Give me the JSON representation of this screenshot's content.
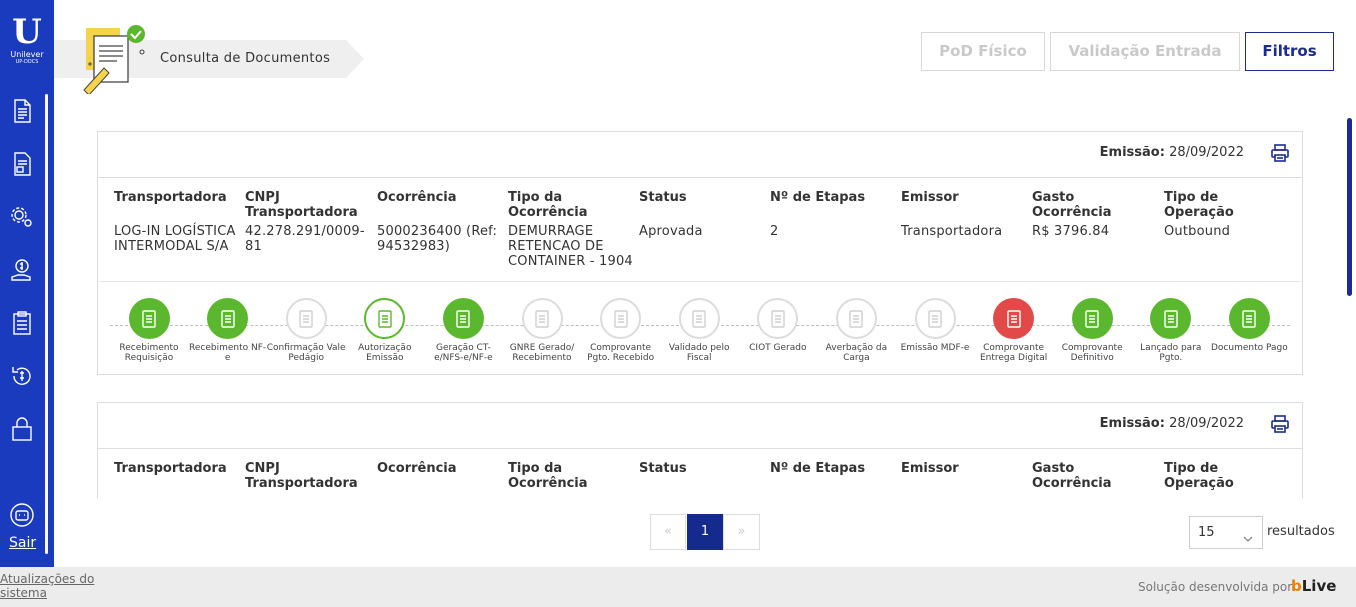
{
  "sidebar": {
    "logo_mark": "U",
    "logo_brand": "Unilever",
    "logo_sub": "UP-DOCS",
    "items": [
      {
        "icon": "document-icon"
      },
      {
        "icon": "document-list-icon"
      },
      {
        "icon": "settings-icon"
      },
      {
        "icon": "money-hand-icon"
      },
      {
        "icon": "clipboard-icon"
      },
      {
        "icon": "currency-return-icon"
      },
      {
        "icon": "lock-icon"
      },
      {
        "icon": "robot-icon"
      }
    ],
    "sair": "Sair"
  },
  "header": {
    "breadcrumb": "Consulta de Documentos",
    "buttons": {
      "pod": "PoD Físico",
      "validacao": "Validação Entrada",
      "filtros": "Filtros"
    }
  },
  "cards": [
    {
      "emissao_label": "Emissão:",
      "emissao_date": "28/09/2022",
      "columns": [
        {
          "header": "Transportadora",
          "value": "LOG-IN LOGÍSTICA INTERMODAL S/A"
        },
        {
          "header": "CNPJ Transportadora",
          "value": "42.278.291/0009-81"
        },
        {
          "header": "Ocorrência",
          "value": "5000236400 (Ref: 94532983)"
        },
        {
          "header": "Tipo da Ocorrência",
          "value": "DEMURRAGE RETENCAO DE CONTAINER - 1904"
        },
        {
          "header": "Status",
          "value": "Aprovada"
        },
        {
          "header": "Nº de Etapas",
          "value": "2"
        },
        {
          "header": "Emissor",
          "value": "Transportadora"
        },
        {
          "header": "Gasto Ocorrência",
          "value": "R$ 3796.84"
        },
        {
          "header": "Tipo de Operação",
          "value": "Outbound"
        }
      ],
      "steps": [
        {
          "label": "Recebimento Requisição",
          "state": "done",
          "icon": "receipt-download-icon"
        },
        {
          "label": "Recebimento NF-e",
          "state": "done",
          "icon": "invoice-icon"
        },
        {
          "label": "Confirmação Vale Pedágio",
          "state": "pending",
          "icon": "toll-icon"
        },
        {
          "label": "Autorização Emissão",
          "state": "current",
          "icon": "clipboard-check-icon"
        },
        {
          "label": "Geração CT-e/NFS-e/NF-e",
          "state": "done",
          "icon": "invoice-icon"
        },
        {
          "label": "GNRE Gerado/ Recebimento",
          "state": "pending",
          "icon": "invoice-icon"
        },
        {
          "label": "Comprovante Pgto. Recebido",
          "state": "pending",
          "icon": "payment-receipt-icon"
        },
        {
          "label": "Validado pelo Fiscal",
          "state": "pending",
          "icon": "document-check-icon"
        },
        {
          "label": "CIOT Gerado",
          "state": "pending",
          "icon": "ciot-icon"
        },
        {
          "label": "Averbação da Carga",
          "state": "pending",
          "icon": "cargo-icon"
        },
        {
          "label": "Emissão MDF-e",
          "state": "pending",
          "icon": "invoice-icon"
        },
        {
          "label": "Comprovante Entrega Digital",
          "state": "error",
          "icon": "barcode-icon"
        },
        {
          "label": "Comprovante Definitivo",
          "state": "done",
          "icon": "document-lines-icon"
        },
        {
          "label": "Lançado para Pgto.",
          "state": "done",
          "icon": "payment-card-icon"
        },
        {
          "label": "Documento Pago",
          "state": "done",
          "icon": "paid-document-icon"
        }
      ]
    },
    {
      "emissao_label": "Emissão:",
      "emissao_date": "28/09/2022",
      "columns": [
        {
          "header": "Transportadora",
          "value": ""
        },
        {
          "header": "CNPJ Transportadora",
          "value": ""
        },
        {
          "header": "Ocorrência",
          "value": ""
        },
        {
          "header": "Tipo da Ocorrência",
          "value": ""
        },
        {
          "header": "Status",
          "value": ""
        },
        {
          "header": "Nº de Etapas",
          "value": ""
        },
        {
          "header": "Emissor",
          "value": ""
        },
        {
          "header": "Gasto Ocorrência",
          "value": ""
        },
        {
          "header": "Tipo de Operação",
          "value": ""
        }
      ]
    }
  ],
  "pagination": {
    "prev": "«",
    "current": "1",
    "next": "»",
    "page_size": "15",
    "resultados": "resultados"
  },
  "footer": {
    "atualizacoes": "Atualizações do sistema",
    "solucao": "Solução desenvolvida por",
    "brand_b": "b",
    "brand_live": "Live"
  },
  "colors": {
    "sidebar": "#1b3bbf",
    "accent": "#142a8c",
    "done": "#5bb82e",
    "error": "#e24a4a",
    "pending": "#dcdcdc"
  }
}
